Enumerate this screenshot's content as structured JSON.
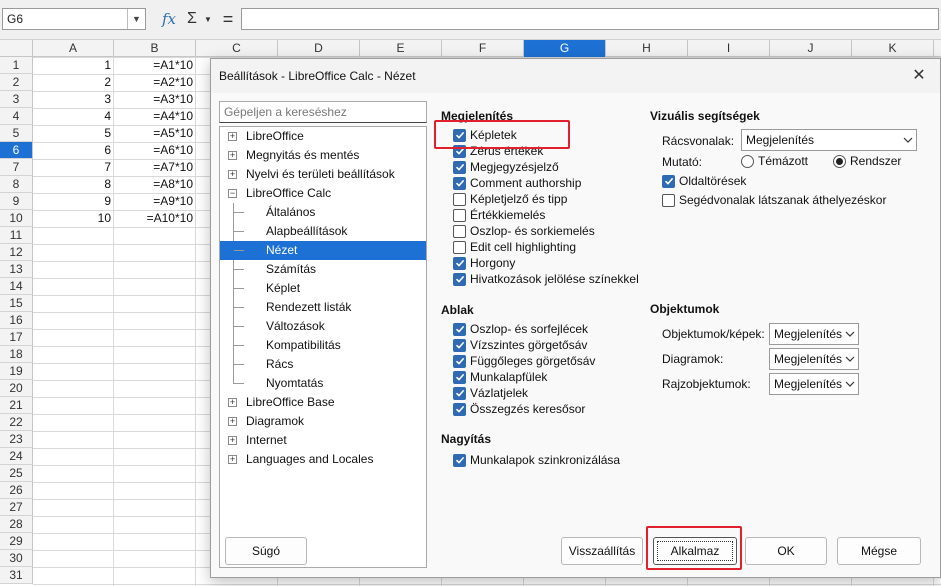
{
  "formula_bar": {
    "name_box": "G6",
    "formula": ""
  },
  "sheet": {
    "columns": [
      "A",
      "B",
      "C",
      "D",
      "E",
      "F",
      "G",
      "H",
      "I",
      "J",
      "K"
    ],
    "active_column": "G",
    "rows": [
      "1",
      "2",
      "3",
      "4",
      "5",
      "6",
      "7",
      "8",
      "9",
      "10",
      "11",
      "12",
      "13",
      "14",
      "15",
      "16",
      "17",
      "18",
      "19",
      "20",
      "21",
      "22",
      "23",
      "24",
      "25",
      "26",
      "27",
      "28",
      "29",
      "30",
      "31"
    ],
    "active_row": "6",
    "col_a": [
      "1",
      "2",
      "3",
      "4",
      "5",
      "6",
      "7",
      "8",
      "9",
      "10"
    ],
    "col_b": [
      "=A1*10",
      "=A2*10",
      "=A3*10",
      "=A4*10",
      "=A5*10",
      "=A6*10",
      "=A7*10",
      "=A8*10",
      "=A9*10",
      "=A10*10"
    ]
  },
  "dialog": {
    "title": "Beállítások - LibreOffice Calc - Nézet",
    "search_placeholder": "Gépeljen a kereséshez",
    "tree": [
      {
        "label": "LibreOffice",
        "level": 0,
        "expander": "+"
      },
      {
        "label": "Megnyitás és mentés",
        "level": 0,
        "expander": "+"
      },
      {
        "label": "Nyelvi és területi beállítások",
        "level": 0,
        "expander": "+"
      },
      {
        "label": "LibreOffice Calc",
        "level": 0,
        "expander": "−"
      },
      {
        "label": "Általános",
        "level": 1
      },
      {
        "label": "Alapbeállítások",
        "level": 1
      },
      {
        "label": "Nézet",
        "level": 1,
        "selected": true
      },
      {
        "label": "Számítás",
        "level": 1
      },
      {
        "label": "Képlet",
        "level": 1
      },
      {
        "label": "Rendezett listák",
        "level": 1
      },
      {
        "label": "Változások",
        "level": 1
      },
      {
        "label": "Kompatibilitás",
        "level": 1
      },
      {
        "label": "Rács",
        "level": 1
      },
      {
        "label": "Nyomtatás",
        "level": 1
      },
      {
        "label": "LibreOffice Base",
        "level": 0,
        "expander": "+"
      },
      {
        "label": "Diagramok",
        "level": 0,
        "expander": "+"
      },
      {
        "label": "Internet",
        "level": 0,
        "expander": "+"
      },
      {
        "label": "Languages and Locales",
        "level": 0,
        "expander": "+"
      }
    ],
    "display": {
      "title": "Megjelenítés",
      "options": [
        {
          "label": "Képletek",
          "checked": true
        },
        {
          "label": "Zérus értékek",
          "checked": true
        },
        {
          "label": "Megjegyzésjelző",
          "checked": true
        },
        {
          "label": "Comment authorship",
          "checked": true
        },
        {
          "label": "Képletjelző és tipp",
          "checked": false
        },
        {
          "label": "Értékkiemelés",
          "checked": false
        },
        {
          "label": "Oszlop- és sorkiemelés",
          "checked": false
        },
        {
          "label": "Edit cell highlighting",
          "checked": false
        },
        {
          "label": "Horgony",
          "checked": true
        },
        {
          "label": "Hivatkozások jelölése színekkel",
          "checked": true
        }
      ]
    },
    "window": {
      "title": "Ablak",
      "options": [
        {
          "label": "Oszlop- és sorfejlécek",
          "checked": true
        },
        {
          "label": "Vízszintes görgetősáv",
          "checked": true
        },
        {
          "label": "Függőleges görgetősáv",
          "checked": true
        },
        {
          "label": "Munkalapfülek",
          "checked": true
        },
        {
          "label": "Vázlatjelek",
          "checked": true
        },
        {
          "label": "Összegzés keresősor",
          "checked": true
        }
      ]
    },
    "zoom": {
      "title": "Nagyítás",
      "options": [
        {
          "label": "Munkalapok szinkronizálása",
          "checked": true
        }
      ]
    },
    "visual_aids": {
      "title": "Vizuális segítségek",
      "gridlines_label": "Rácsvonalak:",
      "gridlines_value": "Megjelenítés",
      "pointer_label": "Mutató:",
      "pointer_options": [
        {
          "label": "Témázott",
          "checked": false
        },
        {
          "label": "Rendszer",
          "checked": true
        }
      ],
      "options": [
        {
          "label": "Oldaltörések",
          "checked": true
        },
        {
          "label": "Segédvonalak látszanak áthelyezéskor",
          "checked": false
        }
      ]
    },
    "objects": {
      "title": "Objektumok",
      "rows": [
        {
          "label": "Objektumok/képek:",
          "value": "Megjelenítés"
        },
        {
          "label": "Diagramok:",
          "value": "Megjelenítés"
        },
        {
          "label": "Rajzobjektumok:",
          "value": "Megjelenítés"
        }
      ]
    },
    "buttons": {
      "help": "Súgó",
      "reset": "Visszaállítás",
      "apply": "Alkalmaz",
      "ok": "OK",
      "cancel": "Mégse"
    }
  },
  "colors": {
    "accent": "#1e71d4",
    "highlight": "#e0202c",
    "checkbox": "#2f6ab3"
  }
}
